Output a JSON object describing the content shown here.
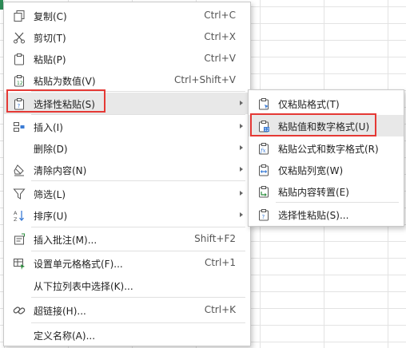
{
  "context_menu": {
    "items": [
      {
        "label": "复制(C)",
        "shortcut": "Ctrl+C",
        "icon": "copy-icon"
      },
      {
        "label": "剪切(T)",
        "shortcut": "Ctrl+X",
        "icon": "scissors-icon"
      },
      {
        "label": "粘贴(P)",
        "shortcut": "Ctrl+V",
        "icon": "paste-icon"
      },
      {
        "label": "粘贴为数值(V)",
        "shortcut": "Ctrl+Shift+V",
        "icon": "paste-values-icon"
      },
      {
        "label": "选择性粘贴(S)",
        "shortcut": "",
        "icon": "paste-special-icon",
        "submenu": true,
        "selected": true
      },
      {
        "label": "插入(I)",
        "shortcut": "",
        "icon": "insert-icon",
        "submenu": true
      },
      {
        "label": "删除(D)",
        "shortcut": "",
        "icon": "",
        "submenu": true
      },
      {
        "label": "清除内容(N)",
        "shortcut": "",
        "icon": "eraser-icon",
        "submenu": true
      },
      {
        "label": "筛选(L)",
        "shortcut": "",
        "icon": "filter-icon",
        "submenu": true
      },
      {
        "label": "排序(U)",
        "shortcut": "",
        "icon": "sort-icon",
        "submenu": true
      },
      {
        "label": "插入批注(M)...",
        "shortcut": "Shift+F2",
        "icon": "comment-icon"
      },
      {
        "label": "设置单元格格式(F)...",
        "shortcut": "Ctrl+1",
        "icon": "format-cells-icon"
      },
      {
        "label": "从下拉列表中选择(K)...",
        "shortcut": "",
        "icon": ""
      },
      {
        "label": "超链接(H)...",
        "shortcut": "Ctrl+K",
        "icon": "link-icon"
      },
      {
        "label": "定义名称(A)...",
        "shortcut": "",
        "icon": ""
      }
    ]
  },
  "paste_special_submenu": {
    "items": [
      {
        "label": "仅粘贴格式(T)",
        "icon": "paste-format-icon"
      },
      {
        "label": "粘贴值和数字格式(U)",
        "icon": "paste-values-numbers-icon",
        "hovered": true
      },
      {
        "label": "粘贴公式和数字格式(R)",
        "icon": "paste-formulas-icon"
      },
      {
        "label": "仅粘贴列宽(W)",
        "icon": "paste-column-width-icon"
      },
      {
        "label": "粘贴内容转置(E)",
        "icon": "paste-transpose-icon"
      },
      {
        "label": "选择性粘贴(S)...",
        "icon": "paste-special-icon"
      }
    ]
  },
  "colors": {
    "highlight_border": "#e53935",
    "hover_bg": "#e8e8e8",
    "accent": "#3a7bd5"
  }
}
